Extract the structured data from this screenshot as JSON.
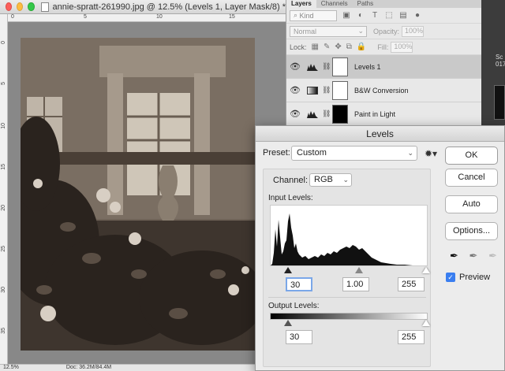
{
  "document": {
    "title": "annie-spratt-261990.jpg @ 12.5% (Levels 1, Layer Mask/8) *",
    "zoom": "12.5%",
    "doc_size": "Doc: 36.2M/84.4M",
    "ruler_ticks_top": [
      "0",
      "5",
      "10",
      "15"
    ],
    "ruler_ticks_left": [
      "0",
      "5",
      "10",
      "15",
      "20",
      "25",
      "30",
      "35"
    ]
  },
  "layers_panel": {
    "tabs": [
      "Layers",
      "Channels",
      "Paths"
    ],
    "filter_kind": "Kind",
    "blend_mode": "Normal",
    "opacity_label": "Opacity:",
    "opacity_value": "100%",
    "lock_label": "Lock:",
    "fill_label": "Fill:",
    "fill_value": "100%",
    "layers": [
      {
        "name": "Levels 1",
        "selected": true,
        "mask": "white"
      },
      {
        "name": "B&W Conversion",
        "selected": false,
        "mask": "white"
      },
      {
        "name": "Paint in Light",
        "selected": false,
        "mask": "black"
      }
    ]
  },
  "right_strip": {
    "text": "Sc\n017"
  },
  "levels_dialog": {
    "title": "Levels",
    "preset_label": "Preset:",
    "preset_value": "Custom",
    "channel_label": "Channel:",
    "channel_value": "RGB",
    "input_levels_label": "Input Levels:",
    "input_black": "30",
    "input_gamma": "1.00",
    "input_white": "255",
    "output_levels_label": "Output Levels:",
    "output_black": "30",
    "output_white": "255",
    "buttons": {
      "ok": "OK",
      "cancel": "Cancel",
      "auto": "Auto",
      "options": "Options..."
    },
    "preview_label": "Preview",
    "preview_checked": true
  }
}
